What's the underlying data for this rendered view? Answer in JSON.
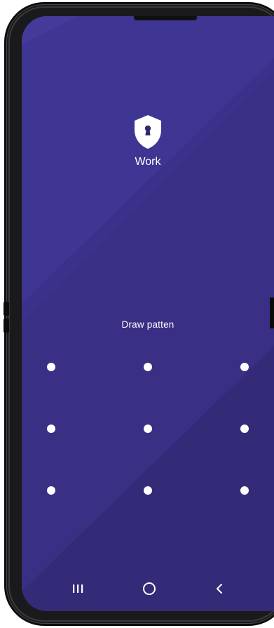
{
  "lock_screen": {
    "profile_icon": "shield-keyhole-icon",
    "profile_label": "Work",
    "prompt": "Draw patten",
    "pattern_dots": [
      {
        "name": "pattern-dot-1"
      },
      {
        "name": "pattern-dot-2"
      },
      {
        "name": "pattern-dot-3"
      },
      {
        "name": "pattern-dot-4"
      },
      {
        "name": "pattern-dot-5"
      },
      {
        "name": "pattern-dot-6"
      },
      {
        "name": "pattern-dot-7"
      },
      {
        "name": "pattern-dot-8"
      },
      {
        "name": "pattern-dot-9"
      }
    ]
  },
  "nav_bar": {
    "recents_icon": "recents-icon",
    "home_icon": "home-icon",
    "back_icon": "back-icon"
  },
  "colors": {
    "background_primary": "#392f84",
    "background_light": "#3f3592",
    "background_dark": "#332b77",
    "text": "#ffffff",
    "phone_frame": "#1a1a1c"
  }
}
